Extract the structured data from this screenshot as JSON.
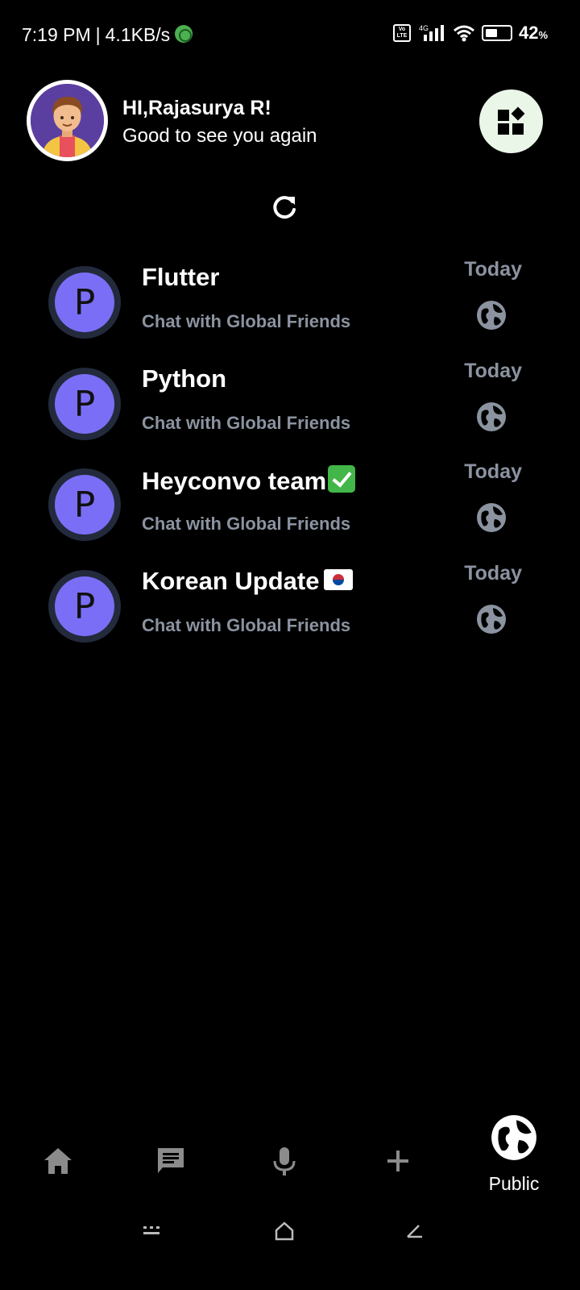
{
  "status_bar": {
    "time": "7:19 PM",
    "separator": "|",
    "speed": "4.1KB/s",
    "network": "4G",
    "volte": "Vo LTE",
    "battery": "42",
    "battery_unit": "%"
  },
  "header": {
    "greeting": "HI,Rajasurya R!",
    "subtitle": "Good to see you again"
  },
  "chats": [
    {
      "avatar_letter": "P",
      "name": "Flutter",
      "emoji": "",
      "subtitle": "Chat with Global Friends",
      "time": "Today"
    },
    {
      "avatar_letter": "P",
      "name": "Python",
      "emoji": "",
      "subtitle": "Chat with Global Friends",
      "time": "Today"
    },
    {
      "avatar_letter": "P",
      "name": "Heyconvo team",
      "emoji": "check",
      "subtitle": "Chat with Global Friends",
      "time": "Today"
    },
    {
      "avatar_letter": "P",
      "name": "Korean Update",
      "emoji": "flag-kr",
      "subtitle": "Chat with Global Friends",
      "time": "Today"
    }
  ],
  "bottom_nav": {
    "items": [
      "home-icon",
      "chat-icon",
      "mic-icon",
      "add-icon"
    ],
    "active_label": "Public"
  },
  "colors": {
    "background": "#000000",
    "avatar_purple": "#7b6ef6",
    "muted_text": "#8b93a0",
    "grid_button": "#eaf7e8"
  }
}
